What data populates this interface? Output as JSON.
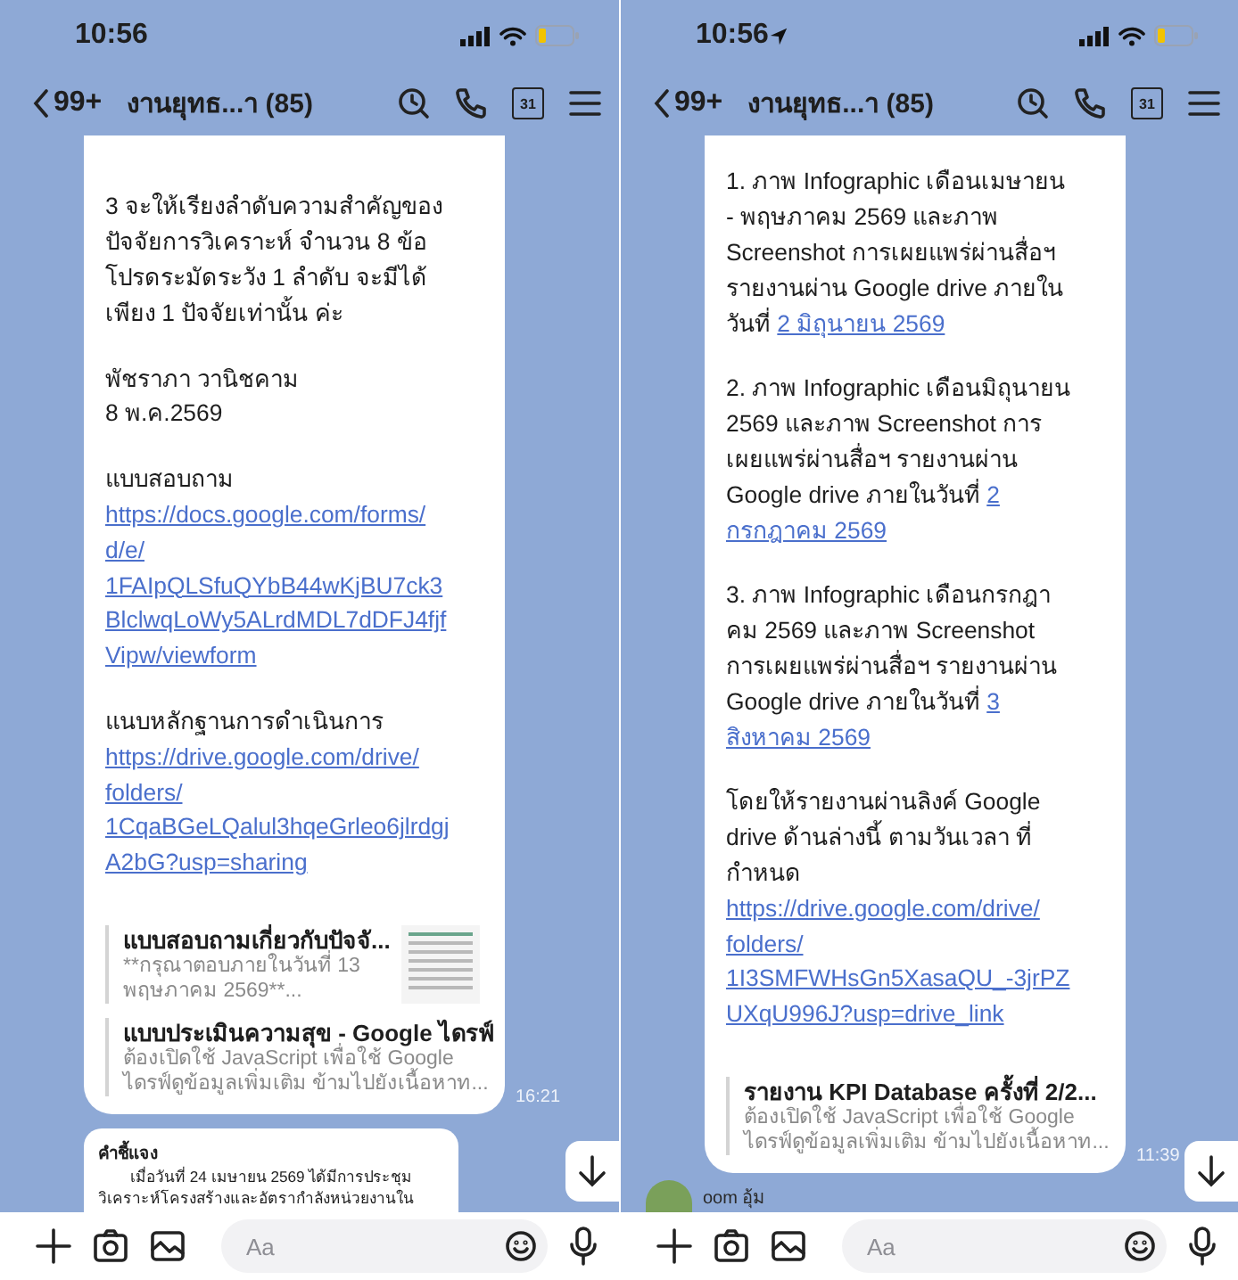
{
  "phones": [
    {
      "status_bar": {
        "time": "10:56",
        "location_on": false
      },
      "header": {
        "back_count": "99+",
        "title": "งานยุทธ...า (85)",
        "calendar_day": "31"
      },
      "message": {
        "paragraphs": [
          [
            {
              "kind": "text",
              "text": "3 จะให้เรียงลำดับความสำคัญของ\nปัจจัยการวิเคราะห์ จำนวน 8 ข้อ\nโปรดระมัดระวัง 1 ลำดับ จะมีได้\nเพียง 1 ปัจจัยเท่านั้น ค่ะ"
            }
          ],
          [
            {
              "kind": "text",
              "text": "พัชราภา วานิชคาม\n8 พ.ค.2569"
            }
          ],
          [
            {
              "kind": "text",
              "text": "แบบสอบถาม"
            },
            {
              "kind": "url_link",
              "text": "https://docs.google.com/forms/\nd/e/\n1FAIpQLSfuQYbB44wKjBU7ck3\nBlclwqLoWy5ALrdMDL7dDFJ4fjf\nVipw/viewform"
            }
          ],
          [
            {
              "kind": "text",
              "text": "แนบหลักฐานการดำเนินการ"
            },
            {
              "kind": "url_link",
              "text": "https://drive.google.com/drive/\nfolders/\n1CqaBGeLQalul3hqeGrleo6jlrdgj\nA2bG?usp=sharing"
            }
          ]
        ],
        "previews": [
          {
            "title": "แบบสอบถามเกี่ยวกับปัจจั...",
            "description": "**กรุณาตอบภายในวันที่ 13\nพฤษภาคม 2569**...",
            "thumbnail": true
          },
          {
            "title": "แบบประเมินความสุข - Google ไดรฟ์",
            "description": "ต้องเปิดใช้ JavaScript เพื่อใช้ Google\nไดรฟ์ดูข้อมูลเพิ่มเติม ข้ามไปยังเนื้อหาท...",
            "thumbnail": false
          }
        ],
        "time": "16:21"
      },
      "next_message": {
        "kind": "card",
        "title": "คำชี้แจง",
        "lines": [
          "เมื่อวันที่ 24 เมษายน 2569 ได้มีการประชุม",
          "วิเคราะห์โครงสร้างและอัตรากำลังหน่วยงานใน"
        ]
      },
      "input": {
        "placeholder": "Aa"
      }
    },
    {
      "status_bar": {
        "time": "10:56",
        "location_on": true
      },
      "header": {
        "back_count": "99+",
        "title": "งานยุทธ...า (85)",
        "calendar_day": "31"
      },
      "message": {
        "paragraphs": [
          [
            {
              "kind": "text",
              "text": "1. ภาพ Infographic เดือนเมษายน\n- พฤษภาคม 2569 และภาพ\nScreenshot การเผยแพร่ผ่านสื่อฯ\nรายงานผ่าน Google drive ภายใน\nวันที่ "
            },
            {
              "kind": "inline_link",
              "text": "2 มิถุนายน 2569"
            }
          ],
          [
            {
              "kind": "text",
              "text": "2. ภาพ Infographic เดือนมิถุนายน\n2569 และภาพ Screenshot การ\nเผยแพร่ผ่านสื่อฯ รายงานผ่าน\nGoogle drive ภายในวันที่ "
            },
            {
              "kind": "inline_link",
              "text": "2"
            },
            {
              "kind": "line_break"
            },
            {
              "kind": "inline_link",
              "text": "กรกฎาคม 2569"
            }
          ],
          [
            {
              "kind": "text",
              "text": "3. ภาพ Infographic เดือนกรกฎา\nคม 2569 และภาพ Screenshot\nการเผยแพร่ผ่านสื่อฯ รายงานผ่าน\nGoogle drive ภายในวันที่ "
            },
            {
              "kind": "inline_link",
              "text": "3"
            },
            {
              "kind": "line_break"
            },
            {
              "kind": "inline_link",
              "text": "สิงหาคม 2569"
            }
          ],
          [
            {
              "kind": "text",
              "text": "โดยให้รายงานผ่านลิงค์ Google\ndrive ด้านล่างนี้ ตามวันเวลา ที่\nกำหนด"
            },
            {
              "kind": "url_link",
              "text": "https://drive.google.com/drive/\nfolders/\n1I3SMFWHsGn5XasaQU_-3jrPZ\nUXqU996J?usp=drive_link"
            }
          ]
        ],
        "previews": [
          {
            "title": "รายงาน KPI Database ครั้งที่ 2/2...",
            "description": "ต้องเปิดใช้ JavaScript เพื่อใช้ Google\nไดรฟ์ดูข้อมูลเพิ่มเติม ข้ามไปยังเนื้อหาท...",
            "thumbnail": false
          }
        ],
        "time": "11:39"
      },
      "next_message": {
        "kind": "sender",
        "name": "oom อุ้ม"
      },
      "input": {
        "placeholder": "Aa"
      }
    }
  ]
}
